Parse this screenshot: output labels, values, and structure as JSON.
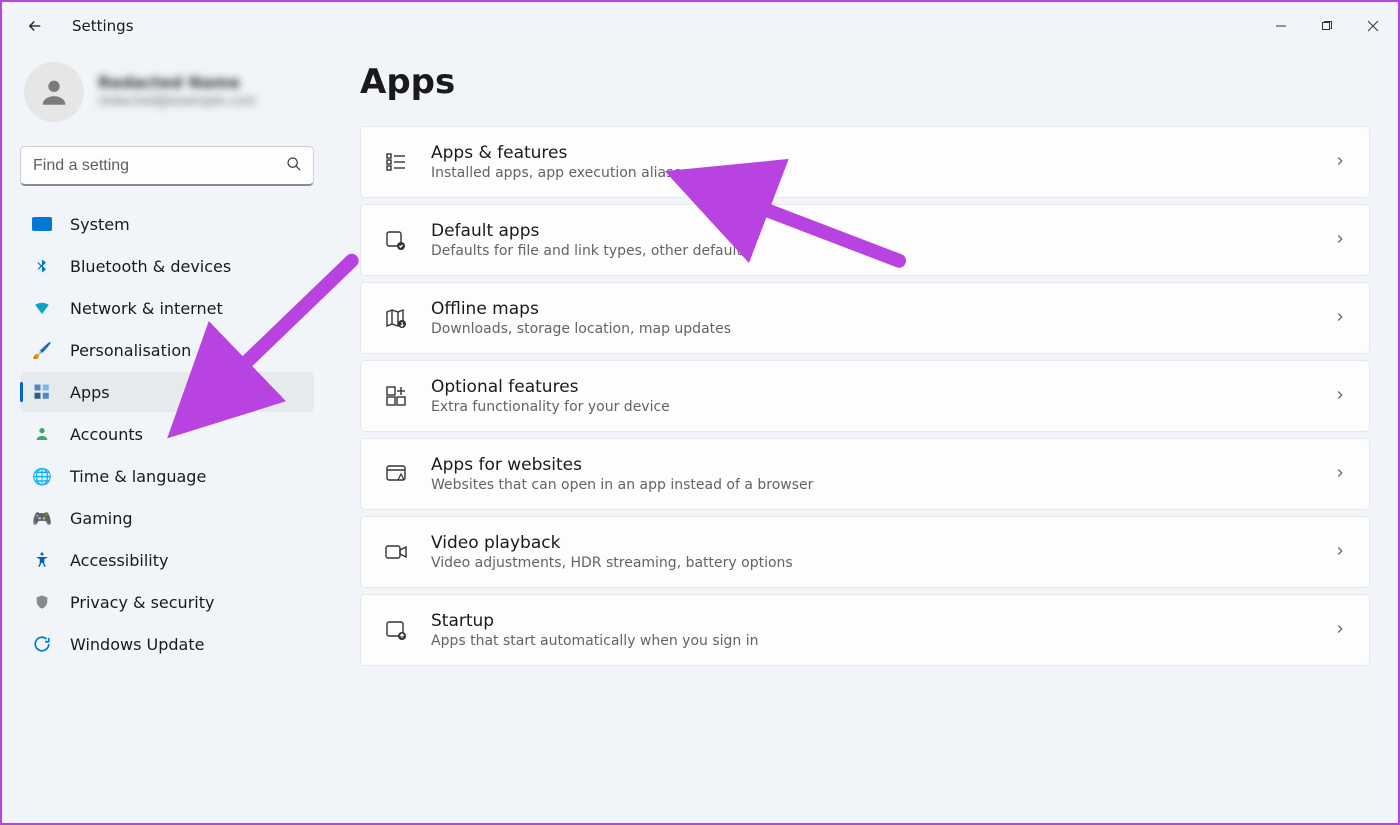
{
  "window": {
    "title": "Settings"
  },
  "profile": {
    "name": "Redacted Name",
    "email": "redacted@example.com"
  },
  "search": {
    "placeholder": "Find a setting"
  },
  "sidebar": {
    "items": [
      {
        "label": "System",
        "icon": "monitor-icon"
      },
      {
        "label": "Bluetooth & devices",
        "icon": "bluetooth-icon"
      },
      {
        "label": "Network & internet",
        "icon": "wifi-icon"
      },
      {
        "label": "Personalisation",
        "icon": "paintbrush-icon"
      },
      {
        "label": "Apps",
        "icon": "apps-icon"
      },
      {
        "label": "Accounts",
        "icon": "person-icon"
      },
      {
        "label": "Time & language",
        "icon": "globe-clock-icon"
      },
      {
        "label": "Gaming",
        "icon": "gamepad-icon"
      },
      {
        "label": "Accessibility",
        "icon": "accessibility-icon"
      },
      {
        "label": "Privacy & security",
        "icon": "shield-icon"
      },
      {
        "label": "Windows Update",
        "icon": "windows-update-icon"
      }
    ],
    "active_index": 4
  },
  "page": {
    "title": "Apps",
    "cards": [
      {
        "title": "Apps & features",
        "subtitle": "Installed apps, app execution aliases",
        "icon": "apps-features-icon"
      },
      {
        "title": "Default apps",
        "subtitle": "Defaults for file and link types, other defaults",
        "icon": "default-apps-icon"
      },
      {
        "title": "Offline maps",
        "subtitle": "Downloads, storage location, map updates",
        "icon": "offline-maps-icon"
      },
      {
        "title": "Optional features",
        "subtitle": "Extra functionality for your device",
        "icon": "optional-features-icon"
      },
      {
        "title": "Apps for websites",
        "subtitle": "Websites that can open in an app instead of a browser",
        "icon": "apps-websites-icon"
      },
      {
        "title": "Video playback",
        "subtitle": "Video adjustments, HDR streaming, battery options",
        "icon": "video-playback-icon"
      },
      {
        "title": "Startup",
        "subtitle": "Apps that start automatically when you sign in",
        "icon": "startup-icon"
      }
    ]
  },
  "annotations": {
    "arrows": [
      {
        "target": "sidebar-item-apps"
      },
      {
        "target": "card-apps-features"
      }
    ],
    "color": "#b843e0"
  }
}
